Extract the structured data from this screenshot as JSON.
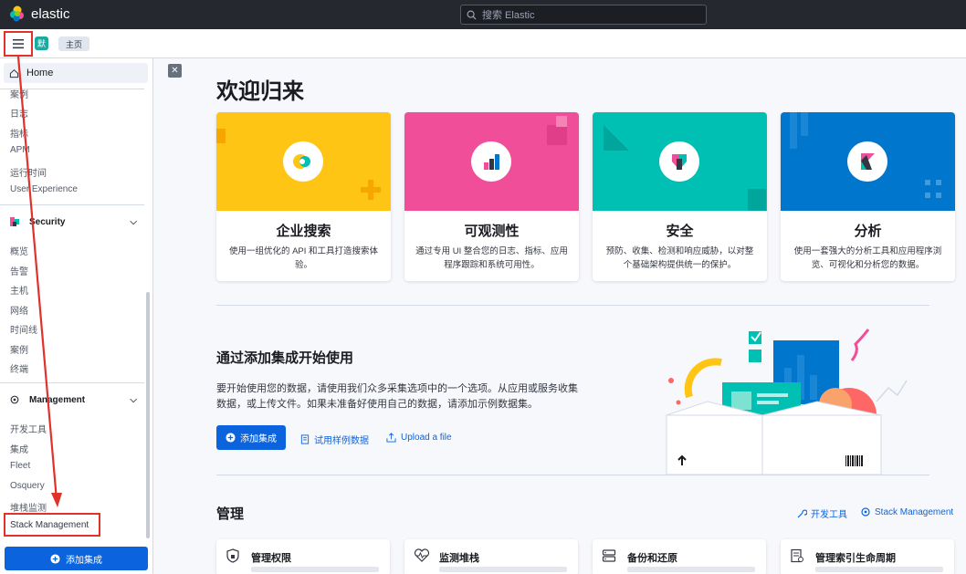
{
  "header": {
    "brand": "elastic",
    "search_placeholder": "搜索 Elastic"
  },
  "subbar": {
    "space_avatar": "默",
    "breadcrumb": "主页"
  },
  "sidebar": {
    "home": "Home",
    "observability_items": [
      "案例",
      "日志",
      "指标",
      "APM",
      "运行时间",
      "User Experience"
    ],
    "security": {
      "title": "Security",
      "items": [
        "概览",
        "告警",
        "主机",
        "网络",
        "时间线",
        "案例",
        "终端"
      ]
    },
    "management": {
      "title": "Management",
      "items": [
        "开发工具",
        "集成",
        "Fleet",
        "Osquery",
        "堆栈监测",
        "Stack Management"
      ]
    },
    "add_integrations": "添加集成"
  },
  "main": {
    "welcome": "欢迎归来",
    "solutions": [
      {
        "title": "企业搜索",
        "desc": "使用一组优化的 API 和工具打造搜索体验。",
        "color": "#fec514"
      },
      {
        "title": "可观测性",
        "desc": "通过专用 UI 整合您的日志、指标、应用程序跟踪和系统可用性。",
        "color": "#f04e98"
      },
      {
        "title": "安全",
        "desc": "预防、收集、检测和响应威胁，以对整个基础架构提供统一的保护。",
        "color": "#00bfb3"
      },
      {
        "title": "分析",
        "desc": "使用一套强大的分析工具和应用程序浏览、可视化和分析您的数据。",
        "color": "#0077cc"
      }
    ],
    "get_started": {
      "title": "通过添加集成开始使用",
      "desc": "要开始使用您的数据，请使用我们众多采集选项中的一个选项。从应用或服务收集数据，或上传文件。如果未准备好使用自己的数据，请添加示例数据集。",
      "add_button": "添加集成",
      "sample_link": "试用样例数据",
      "upload_link": "Upload a file"
    },
    "management": {
      "title": "管理",
      "dev_tools": "开发工具",
      "stack_management": "Stack Management",
      "cards": [
        "管理权限",
        "监测堆栈",
        "备份和还原",
        "管理索引生命周期"
      ]
    }
  },
  "colors": {
    "primary": "#0b64dd",
    "annotation_red": "#e0312b"
  }
}
